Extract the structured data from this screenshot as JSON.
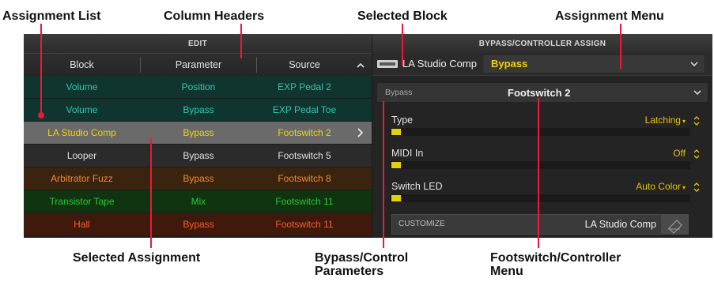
{
  "callouts": {
    "assignment_list": "Assignment List",
    "column_headers": "Column Headers",
    "selected_block": "Selected Block",
    "assignment_menu": "Assignment Menu",
    "selected_assignment": "Selected Assignment",
    "bypass_control_params_line1": "Bypass/Control",
    "bypass_control_params_line2": "Parameters",
    "footswitch_menu_line1": "Footswitch/Controller",
    "footswitch_menu_line2": "Menu"
  },
  "tabs": {
    "edit": "EDIT",
    "assign": "BYPASS/CONTROLLER ASSIGN"
  },
  "columns": [
    "Block",
    "Parameter",
    "Source"
  ],
  "sort_icon": "chevron-up-icon",
  "rows": [
    {
      "block": "Volume",
      "parameter": "Position",
      "source": "EXP Pedal 2",
      "color": "#2fc7b0",
      "bg": "#10352f"
    },
    {
      "block": "Volume",
      "parameter": "Bypass",
      "source": "EXP Pedal Toe",
      "color": "#2fc7b0",
      "bg": "#10352f"
    },
    {
      "block": "LA Studio Comp",
      "parameter": "Bypass",
      "source": "Footswitch 2",
      "color": "#f2d200",
      "bg": "#6a6a6a",
      "selected": true
    },
    {
      "block": "Looper",
      "parameter": "Bypass",
      "source": "Footswitch 5",
      "color": "#e0e0e0",
      "bg": "#2b2b2b"
    },
    {
      "block": "Arbitrator Fuzz",
      "parameter": "Bypass",
      "source": "Footswitch 8",
      "color": "#f08a2a",
      "bg": "#3a2410"
    },
    {
      "block": "Transistor Tape",
      "parameter": "Mix",
      "source": "Footswitch 11",
      "color": "#27c937",
      "bg": "#10340f"
    },
    {
      "block": "Hall",
      "parameter": "Bypass",
      "source": "Footswitch 11",
      "color": "#ff5a2a",
      "bg": "#3f1a0c"
    }
  ],
  "block_bar": {
    "icon": "block-thumbnail-icon",
    "block_name": "LA Studio Comp",
    "assignment": "Bypass"
  },
  "footswitch_bar": {
    "label": "Bypass",
    "value": "Footswitch 2"
  },
  "params": [
    {
      "label": "Type",
      "value": "Latching"
    },
    {
      "label": "MIDI In",
      "value": "Off"
    },
    {
      "label": "Switch LED",
      "value": "Auto Color"
    }
  ],
  "customize": {
    "label": "CUSTOMIZE",
    "value": "LA Studio Comp"
  },
  "colors": {
    "accent": "#e8193c",
    "yellow": "#f2d200"
  }
}
